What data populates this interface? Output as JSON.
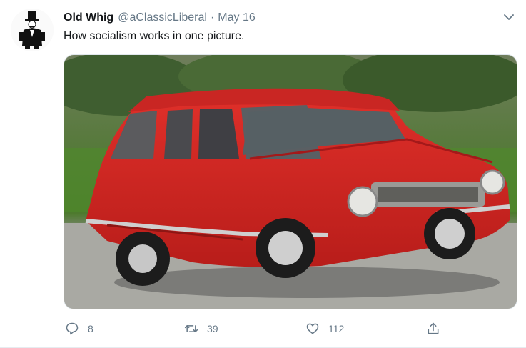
{
  "tweet": {
    "display_name": "Old Whig",
    "handle": "@aClassicLiberal",
    "separator": "·",
    "date": "May 16",
    "text": "How socialism works in one picture.",
    "avatar_icon": "top-hat-man-avatar",
    "media_description": "red-station-wagon-photo"
  },
  "actions": {
    "reply_count": "8",
    "retweet_count": "39",
    "like_count": "112",
    "reply_icon": "reply-icon",
    "retweet_icon": "retweet-icon",
    "like_icon": "heart-icon",
    "share_icon": "share-icon"
  },
  "colors": {
    "text_primary": "#14171a",
    "text_secondary": "#657786",
    "car_red": "#d8231f"
  }
}
